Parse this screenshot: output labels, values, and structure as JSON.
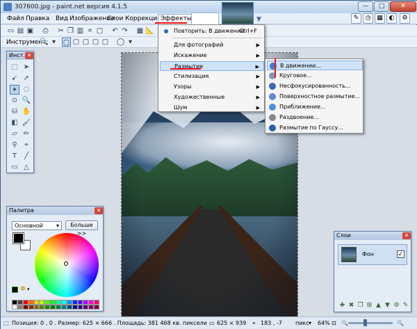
{
  "window": {
    "title": "307600.jpg - paint.net версия 4.1.5",
    "min_label": "—",
    "max_label": "□",
    "close_label": "✕"
  },
  "menubar": {
    "items": [
      "Файл",
      "Правка",
      "Вид",
      "Изображение",
      "Слои",
      "Коррекция",
      "Эффекты"
    ]
  },
  "toolbar2": {
    "tool_label": "Инструмент:"
  },
  "tools_panel": {
    "title": "Инст...",
    "close": "✕"
  },
  "palette_panel": {
    "title": "Палитра",
    "close": "✕",
    "select_value": "Основной",
    "more_button": "Больше >>",
    "swatches": [
      "#000000",
      "#404040",
      "#ff0000",
      "#ff6a00",
      "#ffd800",
      "#b6ff00",
      "#4cff00",
      "#00ff21",
      "#00ff90",
      "#00ffff",
      "#0094ff",
      "#0026ff",
      "#4800ff",
      "#b200ff",
      "#ff00dc",
      "#ff006e",
      "#ffffff",
      "#808080",
      "#7f0000",
      "#7f3300",
      "#7f6a00",
      "#5b7f00",
      "#267f00",
      "#007f0e",
      "#007f46",
      "#007f7f",
      "#004a7f",
      "#00137f",
      "#21007f",
      "#57007f",
      "#7f006e",
      "#7f0037"
    ]
  },
  "layers_panel": {
    "title": "Слои",
    "close": "✕",
    "layer_name": "Фон",
    "check": "✓"
  },
  "statusbar": {
    "position": "Позиция: 0 , 0 . Размер: 625 × 666 . Площадь: 381 468 кв. пиксели",
    "image_size": "625 × 939",
    "cursor": "183 , -7",
    "units": "пикс",
    "zoom": "64%"
  },
  "effects_menu": {
    "repeat": "Повторить: В движении",
    "repeat_shortcut": "Ctrl+F",
    "items": [
      "Для фотографий",
      "Искажение",
      "Размытие",
      "Стилизация",
      "Узоры",
      "Художественные",
      "Шум"
    ]
  },
  "blur_menu": {
    "items": [
      "В движении...",
      "Круговое...",
      "Несфокусированность...",
      "Поверхностное размытие...",
      "Приближение...",
      "Раздвоение...",
      "Размытие по Гауссу..."
    ],
    "icon_colors": [
      "#3a7fd0",
      "#7a9ac0",
      "#3a6ab0",
      "#5a8ad0",
      "#4a90e0",
      "#888888",
      "#2a60b0"
    ]
  },
  "colors": {
    "accent": "#cfe3fb",
    "underline": "#ee1111"
  }
}
